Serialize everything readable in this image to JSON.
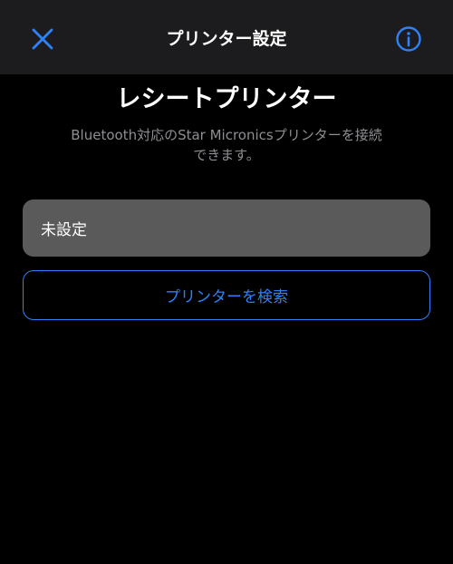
{
  "nav": {
    "title": "プリンター設定",
    "close_icon": "close-x-icon",
    "info_icon": "info-circle-icon"
  },
  "main": {
    "heading": "レシートプリンター",
    "description_line1": "Bluetooth対応のStar Micronicsプリンターを接続",
    "description_line2": "できます。",
    "printer_status": "未設定",
    "search_button_label": "プリンターを検索"
  },
  "colors": {
    "accent": "#2f81f7",
    "background": "#000000",
    "nav_background": "#1c1c1e",
    "row_background": "#5a5a5a",
    "secondary_text": "#8e8e93"
  }
}
